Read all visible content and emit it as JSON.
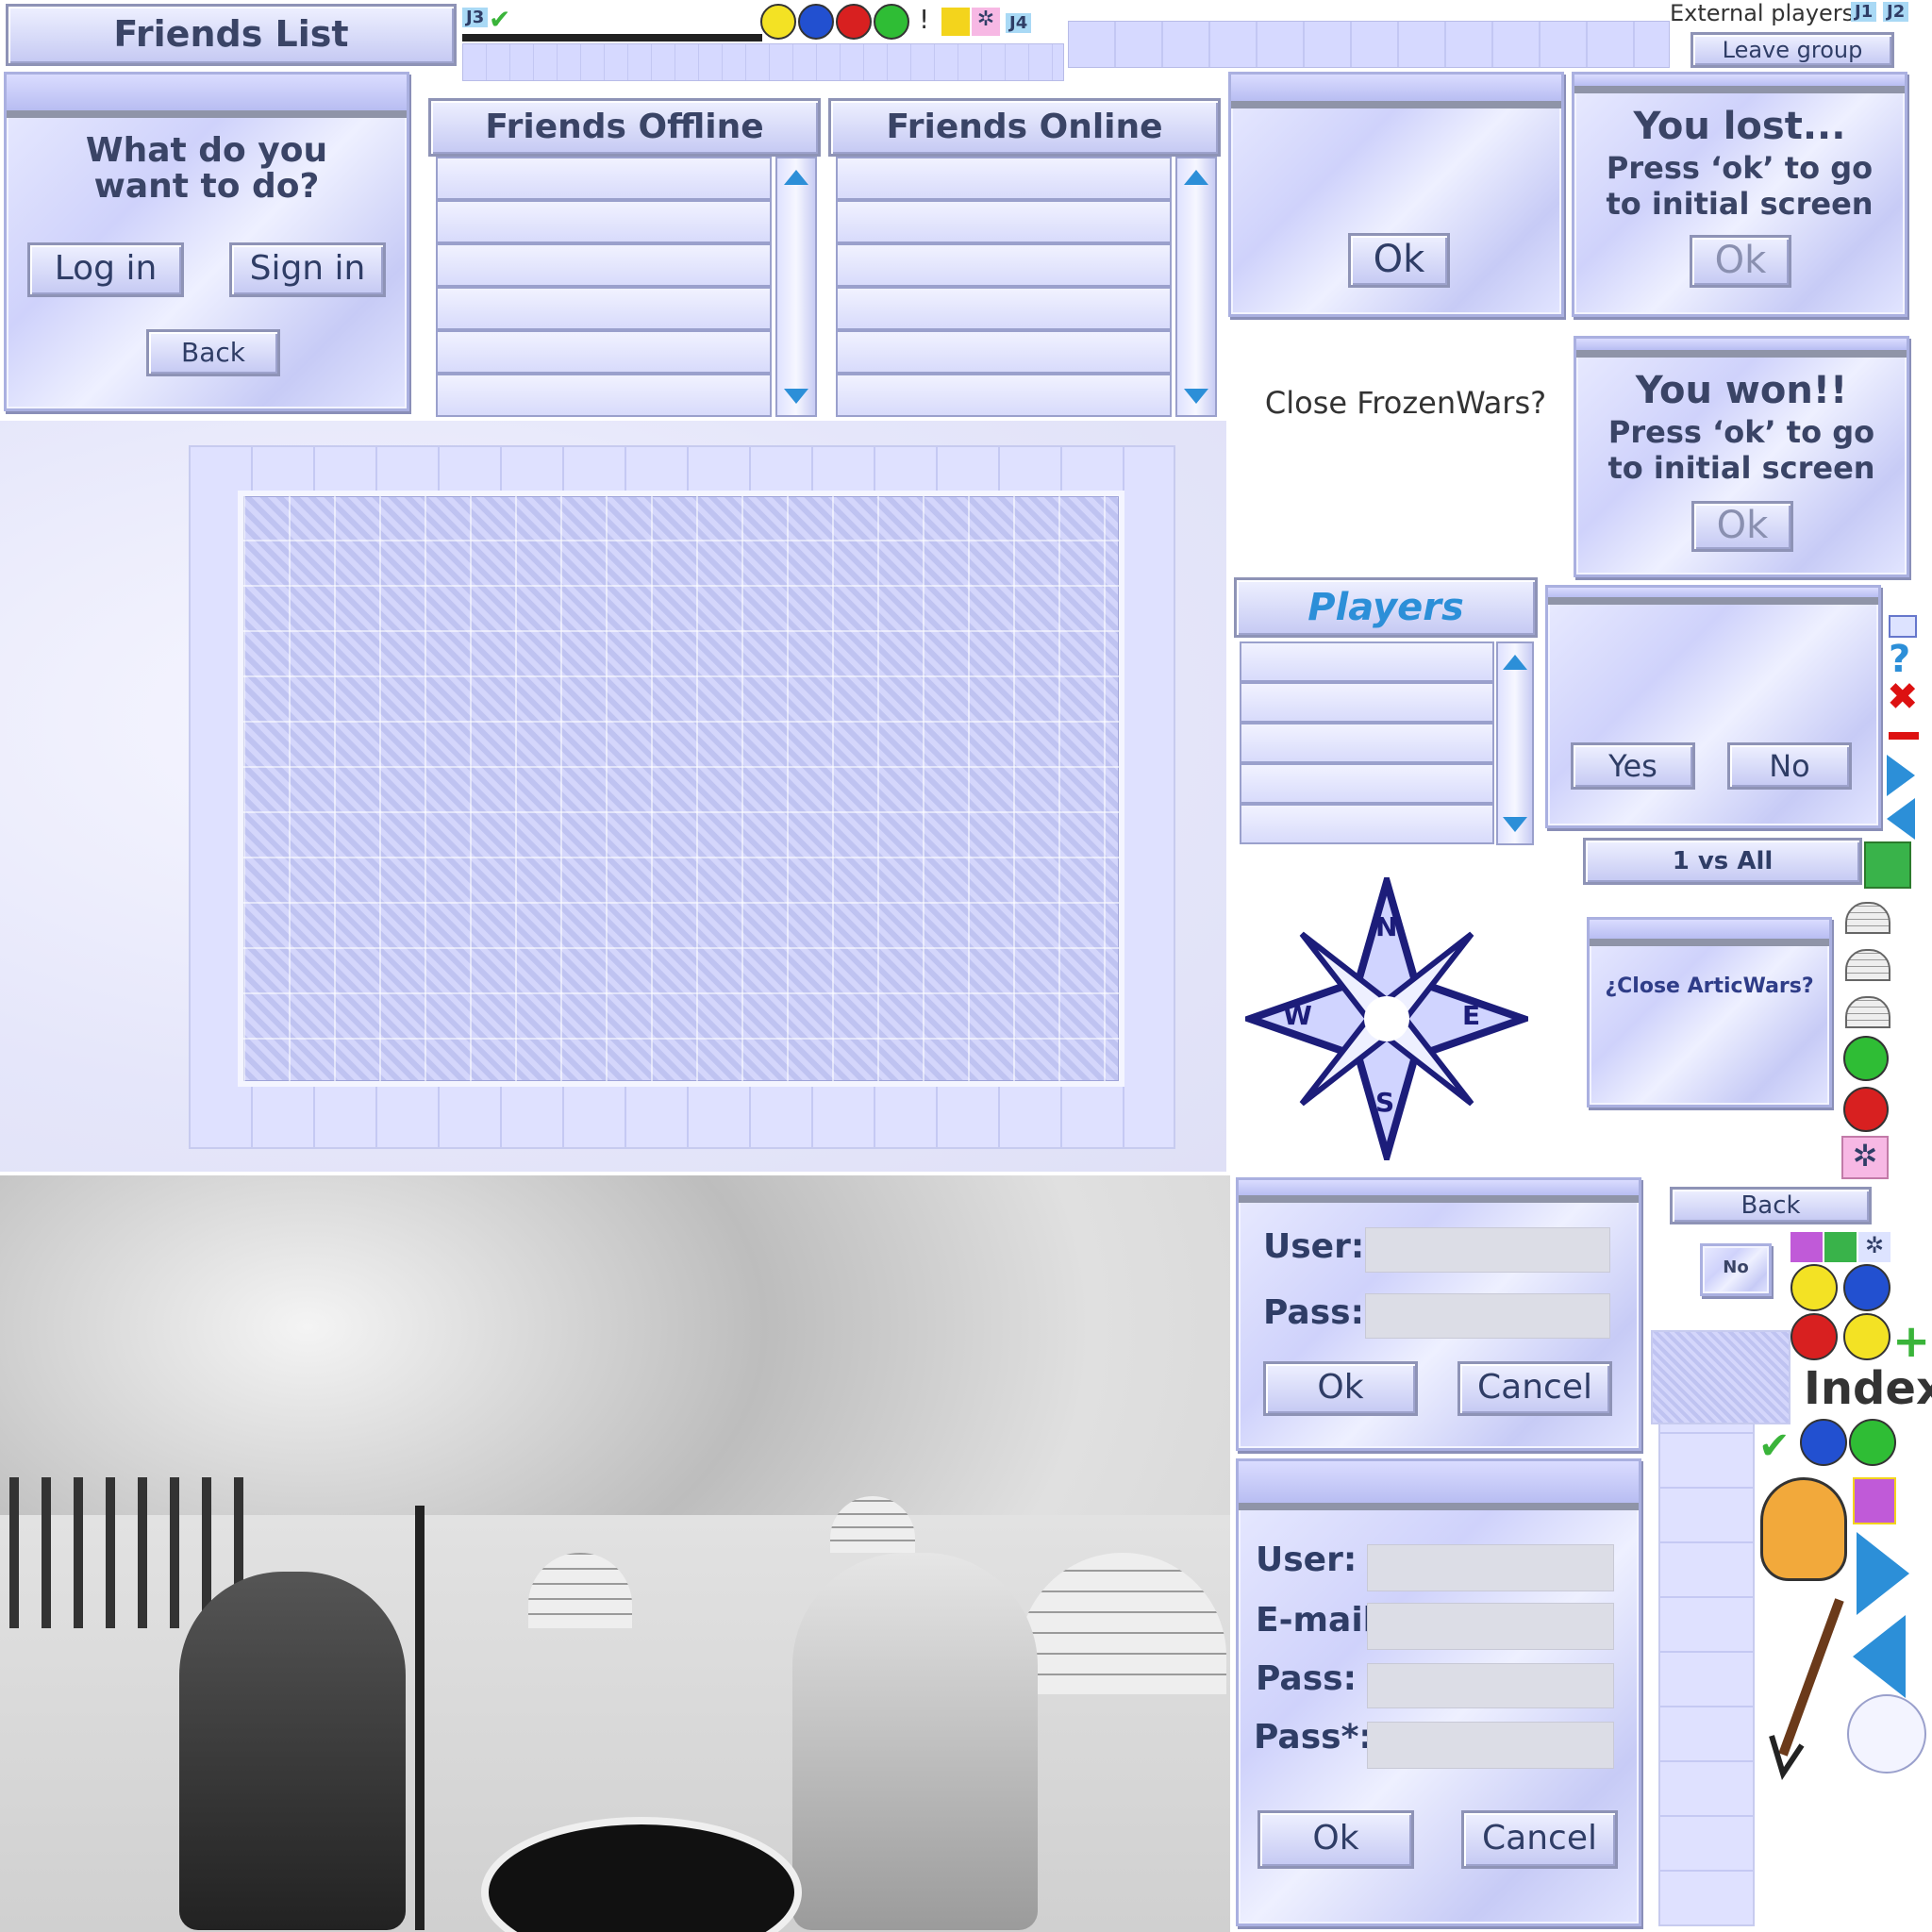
{
  "friends_list": {
    "title": "Friends List"
  },
  "topbar": {
    "j3": "J3",
    "j4": "J4",
    "j1": "J1",
    "j2": "J2",
    "external_players": "External players",
    "leave_group": "Leave group"
  },
  "menu_dialog": {
    "question": "What do you want to do?",
    "login": "Log in",
    "signin": "Sign in",
    "back": "Back"
  },
  "friends_offline": {
    "title": "Friends Offline"
  },
  "friends_online": {
    "title": "Friends Online"
  },
  "ok_dialog": {
    "ok": "Ok"
  },
  "lost_dialog": {
    "title": "You lost...",
    "message": "Press ‘ok’ to go to initial screen",
    "ok": "Ok"
  },
  "close_prompt": "Close FrozenWars?",
  "won_dialog": {
    "title": "You won!!",
    "message": "Press ‘ok’ to go to initial screen",
    "ok": "Ok"
  },
  "players": {
    "title": "Players"
  },
  "yes_no": {
    "yes": "Yes",
    "no": "No"
  },
  "mode": {
    "label": "1 vs All"
  },
  "compass": {
    "n": "N",
    "s": "S",
    "e": "E",
    "w": "W"
  },
  "close_artic": {
    "text": "¿Close ArticWars?"
  },
  "login_form": {
    "user": "User:",
    "pass": "Pass:",
    "ok": "Ok",
    "cancel": "Cancel"
  },
  "register_form": {
    "user": "User:",
    "email": "E-mail:",
    "pass": "Pass:",
    "pass_confirm": "Pass*:",
    "ok": "Ok",
    "cancel": "Cancel"
  },
  "side": {
    "back": "Back",
    "no": "No",
    "index": "Index"
  },
  "colors": {
    "ice": "#cfd2fb",
    "accent": "#2c8fd8",
    "text": "#3a4466"
  }
}
